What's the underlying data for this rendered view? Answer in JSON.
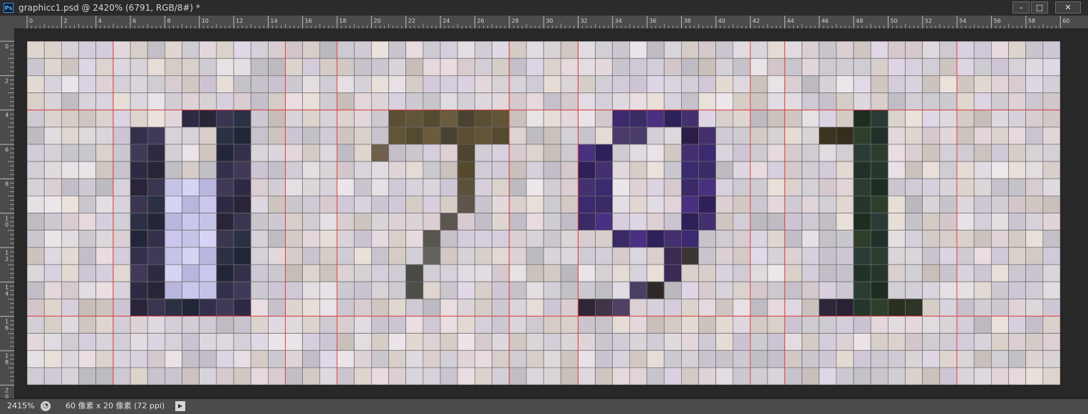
{
  "window": {
    "app_icon": "Ps",
    "title": "graphicc1.psd @ 2420% (6791, RGB/8#) *",
    "min_icon": "minimize-icon",
    "max_icon": "maximize-icon",
    "close_icon": "close-icon"
  },
  "rulers": {
    "top_labels": [
      "0",
      "2",
      "4",
      "6",
      "8",
      "10",
      "12",
      "14",
      "16",
      "18",
      "20",
      "22",
      "24",
      "26",
      "28",
      "30",
      "32",
      "34",
      "36",
      "38",
      "40",
      "42",
      "44",
      "46",
      "48",
      "50",
      "52",
      "54",
      "56",
      "58",
      "60"
    ],
    "left_labels": [
      "0",
      "2",
      "4",
      "6",
      "8",
      "10",
      "12",
      "14",
      "16",
      "18",
      "20"
    ]
  },
  "guides": {
    "vertical": [
      5,
      15,
      18,
      28,
      32,
      42,
      44,
      54
    ],
    "horizontal": [
      4,
      16
    ],
    "color": "#e04040"
  },
  "status": {
    "zoom": "2415%",
    "doc_info": "60 像素 x 20 像素 (72 ppi)",
    "info_icon": "document-status-icon",
    "menu_icon": "play-arrow-icon"
  }
}
